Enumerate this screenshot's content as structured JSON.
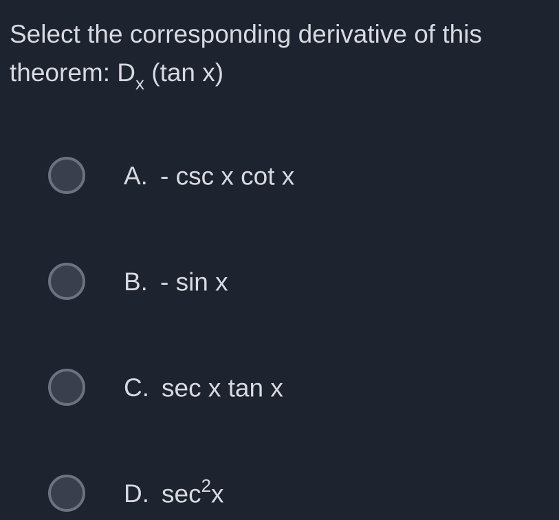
{
  "question": {
    "prefix": "Select the corresponding derivative of this theorem: D",
    "subscript": "x",
    "suffix": " (tan x)"
  },
  "options": [
    {
      "letter": "A.",
      "text": "- csc x cot x",
      "sup": "",
      "suffix": ""
    },
    {
      "letter": "B.",
      "text": "- sin x",
      "sup": "",
      "suffix": ""
    },
    {
      "letter": "C.",
      "text": "sec x tan x",
      "sup": "",
      "suffix": ""
    },
    {
      "letter": "D.",
      "text": "sec",
      "sup": "2",
      "suffix": "x"
    }
  ]
}
